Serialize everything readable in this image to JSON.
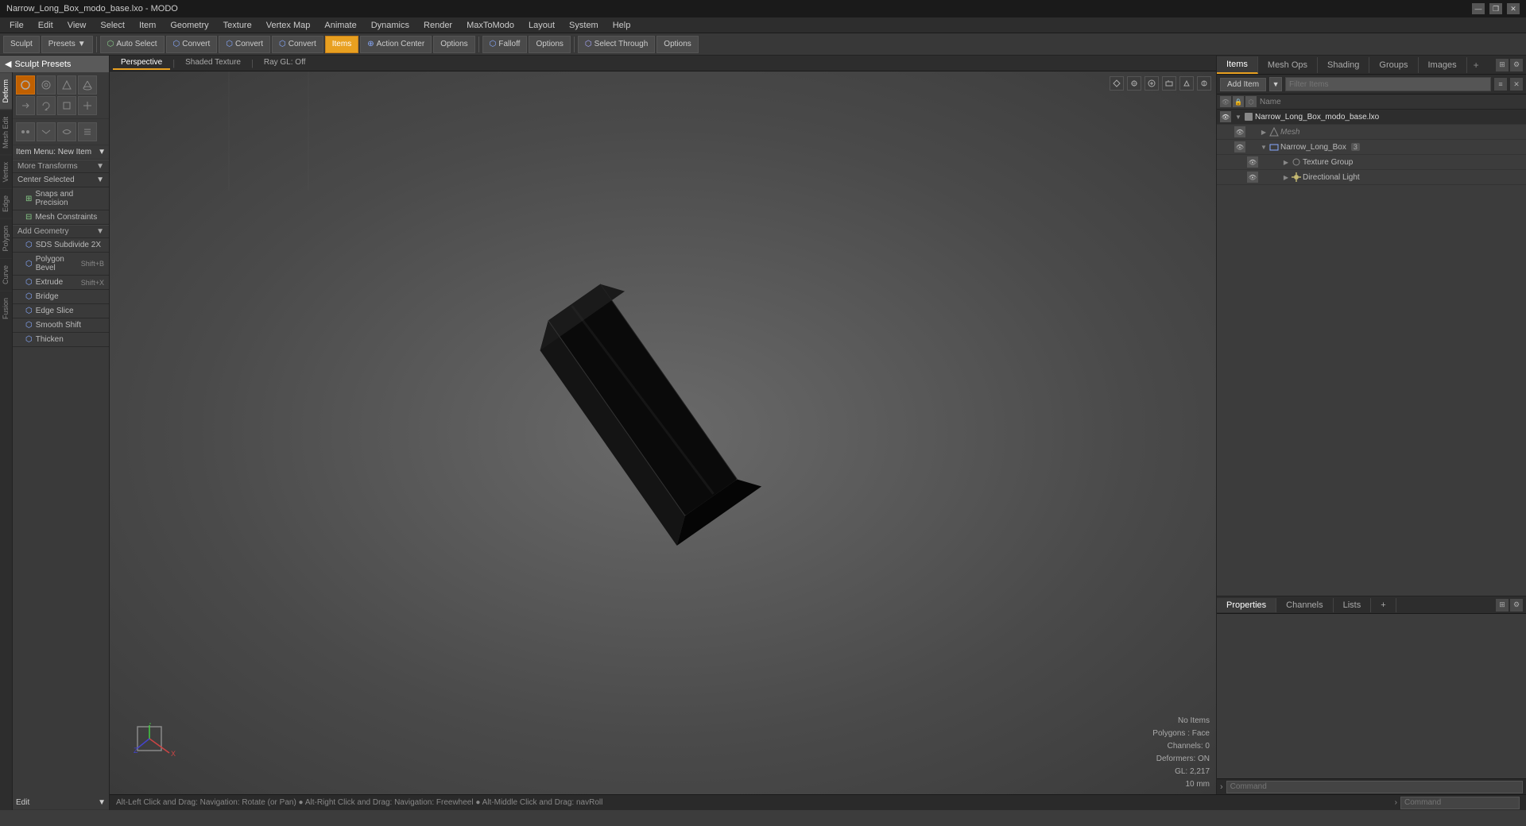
{
  "titlebar": {
    "title": "Narrow_Long_Box_modo_base.lxo - MODO",
    "controls": [
      "—",
      "❐",
      "✕"
    ]
  },
  "menubar": {
    "items": [
      "File",
      "Edit",
      "View",
      "Select",
      "Item",
      "Geometry",
      "Texture",
      "Vertex Map",
      "Animate",
      "Dynamics",
      "Render",
      "MaxToModo",
      "Layout",
      "System",
      "Help"
    ]
  },
  "toolbar": {
    "sculpt_label": "Sculpt",
    "presets_label": "Presets",
    "auto_select_label": "Auto Select",
    "convert1_label": "Convert",
    "convert2_label": "Convert",
    "convert3_label": "Convert",
    "convert4_label": "Convert",
    "items_label": "Items",
    "action_center_label": "Action Center",
    "options1_label": "Options",
    "falloff_label": "Falloff",
    "options2_label": "Options",
    "select_through_label": "Select Through",
    "options3_label": "Options"
  },
  "viewport": {
    "tabs": [
      "Perspective",
      "Shaded Texture",
      "Ray GL: Off"
    ],
    "active_tab": "Perspective",
    "status": {
      "no_items": "No Items",
      "polygons": "Polygons : Face",
      "channels": "Channels: 0",
      "deformers": "Deformers: ON",
      "gl": "GL: 2,217",
      "size": "10 mm"
    }
  },
  "sidebar": {
    "sculpt_presets": "Sculpt Presets",
    "tabs": [
      "Deform",
      "Mesh Edit",
      "Vertex",
      "Edge",
      "Polygon",
      "Curve",
      "Fusion"
    ],
    "tool_icons_row1": [
      "circle",
      "ring",
      "tri",
      "cone"
    ],
    "tool_icons_row2": [
      "arrow",
      "rotate",
      "scale",
      "transform"
    ],
    "item_menu_label": "Item Menu: New Item",
    "more_transforms": "More Transforms",
    "center_selected": "Center Selected",
    "snaps_precision": "Snaps and Precision",
    "mesh_constraints": "Mesh Constraints",
    "add_geometry": "Add Geometry",
    "tools": [
      {
        "label": "SDS Subdivide 2X",
        "shortcut": ""
      },
      {
        "label": "Polygon Bevel",
        "shortcut": "Shift+B"
      },
      {
        "label": "Extrude",
        "shortcut": "Shift+X"
      },
      {
        "label": "Bridge",
        "shortcut": ""
      },
      {
        "label": "Edge Slice",
        "shortcut": ""
      },
      {
        "label": "Smooth Shift",
        "shortcut": ""
      },
      {
        "label": "Thicken",
        "shortcut": ""
      }
    ],
    "edit_label": "Edit"
  },
  "right_panel": {
    "tabs": [
      "Items",
      "Mesh Ops",
      "Shading",
      "Groups",
      "Images"
    ],
    "add_item_label": "Add Item",
    "filter_placeholder": "Filter Items",
    "col_header": "Name",
    "tree": [
      {
        "level": 0,
        "label": "Narrow_Long_Box_modo_base.lxo",
        "type": "scene",
        "expanded": true
      },
      {
        "level": 1,
        "label": "Mesh",
        "type": "mesh",
        "expanded": false,
        "italic": true
      },
      {
        "level": 1,
        "label": "Narrow_Long_Box",
        "type": "mesh",
        "expanded": true,
        "badge": "3"
      },
      {
        "level": 2,
        "label": "Texture Group",
        "type": "texture"
      },
      {
        "level": 2,
        "label": "Directional Light",
        "type": "light"
      }
    ]
  },
  "bottom_right_panel": {
    "tabs": [
      "Properties",
      "Channels",
      "Lists"
    ],
    "command_placeholder": "Command"
  },
  "statusbar": {
    "hint": "Alt-Left Click and Drag: Navigation: Rotate (or Pan) ● Alt-Right Click and Drag: Navigation: Freewheel ● Alt-Middle Click and Drag: navRoll",
    "arrow_label": "›",
    "command_label": "Command"
  }
}
